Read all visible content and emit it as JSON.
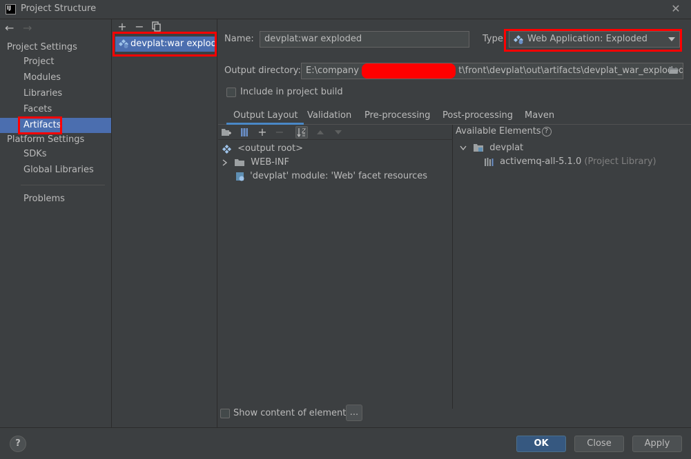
{
  "window": {
    "title": "Project Structure",
    "close_glyph": "✕",
    "icon_text": "IJ"
  },
  "nav": {
    "back_glyph": "←",
    "forward_glyph": "→"
  },
  "sidebar": {
    "project_settings_header": "Project Settings",
    "project_items": [
      {
        "label": "Project"
      },
      {
        "label": "Modules"
      },
      {
        "label": "Libraries"
      },
      {
        "label": "Facets"
      },
      {
        "label": "Artifacts",
        "selected": true
      }
    ],
    "platform_settings_header": "Platform Settings",
    "platform_items": [
      {
        "label": "SDKs"
      },
      {
        "label": "Global Libraries"
      }
    ],
    "problems_label": "Problems"
  },
  "artifacts": {
    "toolbar": {
      "add": "+",
      "remove": "−"
    },
    "items": [
      {
        "label": "devplat:war exploded"
      }
    ]
  },
  "form": {
    "name_label": "Name:",
    "name_value": "devplat:war exploded",
    "type_label": "Type:",
    "type_value": "Web Application: Exploded",
    "output_label": "Output directory:",
    "output_prefix": "E:\\company",
    "output_suffix": "t\\front\\devplat\\out\\artifacts\\devplat_war_exploded",
    "include_build_label": "Include in project build"
  },
  "tabs": [
    {
      "label": "Output Layout",
      "active": true
    },
    {
      "label": "Validation"
    },
    {
      "label": "Pre-processing"
    },
    {
      "label": "Post-processing"
    },
    {
      "label": "Maven"
    }
  ],
  "layout_tree": [
    {
      "label": "<output root>",
      "icon": "output-root-icon"
    },
    {
      "label": "WEB-INF",
      "icon": "folder-icon",
      "expandable": true
    },
    {
      "label": "'devplat' module: 'Web' facet resources",
      "icon": "web-facet-icon"
    }
  ],
  "available": {
    "header": "Available Elements",
    "help_glyph": "?",
    "module": "devplat",
    "library_name": "activemq-all-5.1.0",
    "library_note": "(Project Library)"
  },
  "show_content_label": "Show content of elements",
  "ellipsis": "...",
  "buttons": {
    "ok": "OK",
    "close": "Close",
    "apply": "Apply",
    "help": "?"
  },
  "colors": {
    "selection": "#4b6eaf",
    "annotation": "#ff0000",
    "background": "#3c3f41"
  }
}
